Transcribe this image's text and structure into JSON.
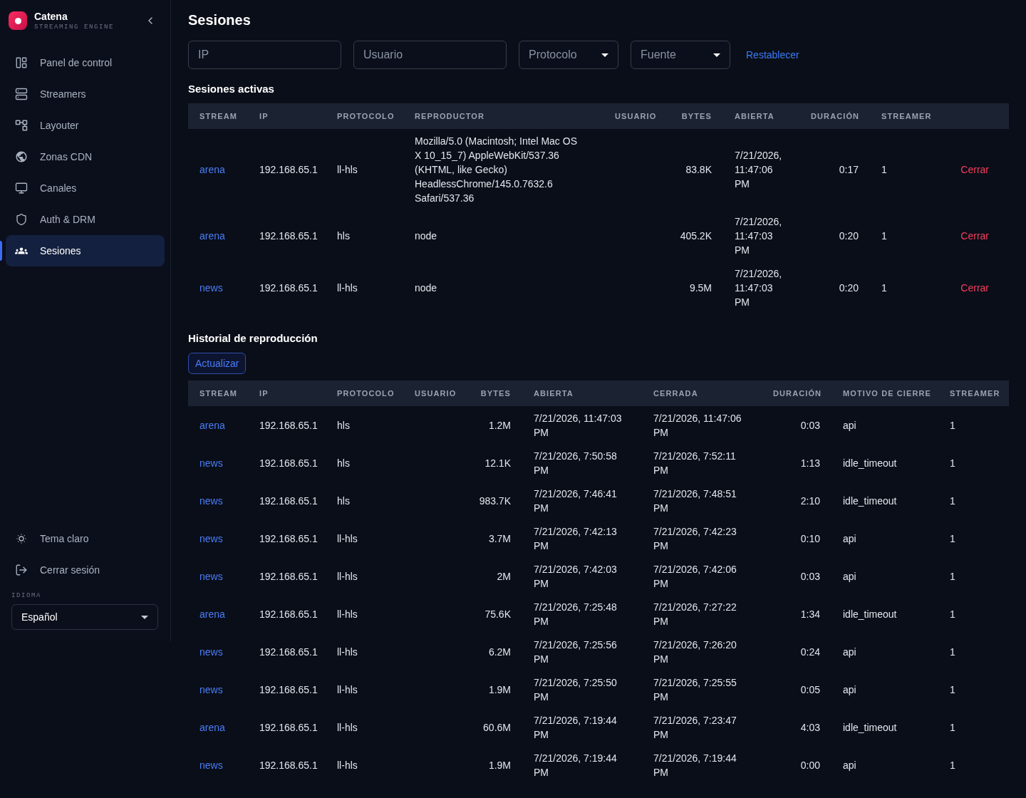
{
  "sidebar": {
    "brand": {
      "name": "Catena",
      "tagline": "STREAMING ENGINE"
    },
    "items": [
      {
        "label": "Panel de control",
        "selected": false
      },
      {
        "label": "Streamers",
        "selected": false
      },
      {
        "label": "Layouter",
        "selected": false
      },
      {
        "label": "Zonas CDN",
        "selected": false
      },
      {
        "label": "Canales",
        "selected": false
      },
      {
        "label": "Auth & DRM",
        "selected": false
      },
      {
        "label": "Sesiones",
        "selected": true
      }
    ],
    "footer_items": [
      {
        "label": "Tema claro"
      },
      {
        "label": "Cerrar sesión"
      }
    ],
    "language": {
      "label": "IDIOMA",
      "value": "Español"
    }
  },
  "page": {
    "title": "Sesiones"
  },
  "filters": {
    "fields": [
      {
        "kind": "input",
        "placeholder": "IP"
      },
      {
        "kind": "input",
        "placeholder": "Usuario"
      },
      {
        "kind": "select",
        "placeholder": "Protocolo"
      },
      {
        "kind": "select",
        "placeholder": "Fuente"
      }
    ],
    "reset": "Restablecer"
  },
  "active_sessions": {
    "title": "Sesiones activas",
    "columns": [
      "STREAM",
      "IP",
      "PROTOCOLO",
      "REPRODUCTOR",
      "USUARIO",
      "BYTES",
      "ABIERTA",
      "DURACIÓN",
      "STREAMER"
    ],
    "rows": [
      {
        "stream": "arena",
        "ip": "192.168.65.1",
        "protocol": "ll-hls",
        "player": "Mozilla/5.0 (Macintosh; Intel Mac OS X 10_15_7) AppleWebKit/537.36 (KHTML, like Gecko) HeadlessChrome/145.0.7632.6 Safari/537.36",
        "bytes": "83.8K",
        "opened": "7/21/2026, 11:47:06 PM",
        "duration": "0:17",
        "streamer": "1",
        "action": "Cerrar"
      },
      {
        "stream": "arena",
        "ip": "192.168.65.1",
        "protocol": "hls",
        "player": "node",
        "bytes": "405.2K",
        "opened": "7/21/2026, 11:47:03 PM",
        "duration": "0:20",
        "streamer": "1",
        "action": "Cerrar"
      },
      {
        "stream": "news",
        "ip": "192.168.65.1",
        "protocol": "ll-hls",
        "player": "node",
        "bytes": "9.5M",
        "opened": "7/21/2026, 11:47:03 PM",
        "duration": "0:20",
        "streamer": "1",
        "action": "Cerrar"
      }
    ]
  },
  "history": {
    "title": "Historial de reproducción",
    "refresh": "Actualizar",
    "columns": [
      "STREAM",
      "IP",
      "PROTOCOLO",
      "USUARIO",
      "BYTES",
      "ABIERTA",
      "CERRADA",
      "DURACIÓN",
      "MOTIVO DE CIERRE",
      "STREAMER"
    ],
    "rows": [
      {
        "stream": "arena",
        "ip": "192.168.65.1",
        "protocol": "hls",
        "bytes": "1.2M",
        "opened": "7/21/2026, 11:47:03 PM",
        "closed": "7/21/2026, 11:47:06 PM",
        "duration": "0:03",
        "close_reason": "api",
        "streamer": "1"
      },
      {
        "stream": "news",
        "ip": "192.168.65.1",
        "protocol": "hls",
        "bytes": "12.1K",
        "opened": "7/21/2026, 7:50:58 PM",
        "closed": "7/21/2026, 7:52:11 PM",
        "duration": "1:13",
        "close_reason": "idle_timeout",
        "streamer": "1"
      },
      {
        "stream": "news",
        "ip": "192.168.65.1",
        "protocol": "hls",
        "bytes": "983.7K",
        "opened": "7/21/2026, 7:46:41 PM",
        "closed": "7/21/2026, 7:48:51 PM",
        "duration": "2:10",
        "close_reason": "idle_timeout",
        "streamer": "1"
      },
      {
        "stream": "news",
        "ip": "192.168.65.1",
        "protocol": "ll-hls",
        "bytes": "3.7M",
        "opened": "7/21/2026, 7:42:13 PM",
        "closed": "7/21/2026, 7:42:23 PM",
        "duration": "0:10",
        "close_reason": "api",
        "streamer": "1"
      },
      {
        "stream": "news",
        "ip": "192.168.65.1",
        "protocol": "ll-hls",
        "bytes": "2M",
        "opened": "7/21/2026, 7:42:03 PM",
        "closed": "7/21/2026, 7:42:06 PM",
        "duration": "0:03",
        "close_reason": "api",
        "streamer": "1"
      },
      {
        "stream": "arena",
        "ip": "192.168.65.1",
        "protocol": "ll-hls",
        "bytes": "75.6K",
        "opened": "7/21/2026, 7:25:48 PM",
        "closed": "7/21/2026, 7:27:22 PM",
        "duration": "1:34",
        "close_reason": "idle_timeout",
        "streamer": "1"
      },
      {
        "stream": "news",
        "ip": "192.168.65.1",
        "protocol": "ll-hls",
        "bytes": "6.2M",
        "opened": "7/21/2026, 7:25:56 PM",
        "closed": "7/21/2026, 7:26:20 PM",
        "duration": "0:24",
        "close_reason": "api",
        "streamer": "1"
      },
      {
        "stream": "news",
        "ip": "192.168.65.1",
        "protocol": "ll-hls",
        "bytes": "1.9M",
        "opened": "7/21/2026, 7:25:50 PM",
        "closed": "7/21/2026, 7:25:55 PM",
        "duration": "0:05",
        "close_reason": "api",
        "streamer": "1"
      },
      {
        "stream": "arena",
        "ip": "192.168.65.1",
        "protocol": "ll-hls",
        "bytes": "60.6M",
        "opened": "7/21/2026, 7:19:44 PM",
        "closed": "7/21/2026, 7:23:47 PM",
        "duration": "4:03",
        "close_reason": "idle_timeout",
        "streamer": "1"
      },
      {
        "stream": "news",
        "ip": "192.168.65.1",
        "protocol": "ll-hls",
        "bytes": "1.9M",
        "opened": "7/21/2026, 7:19:44 PM",
        "closed": "7/21/2026, 7:19:44 PM",
        "duration": "0:00",
        "close_reason": "api",
        "streamer": "1"
      }
    ]
  }
}
